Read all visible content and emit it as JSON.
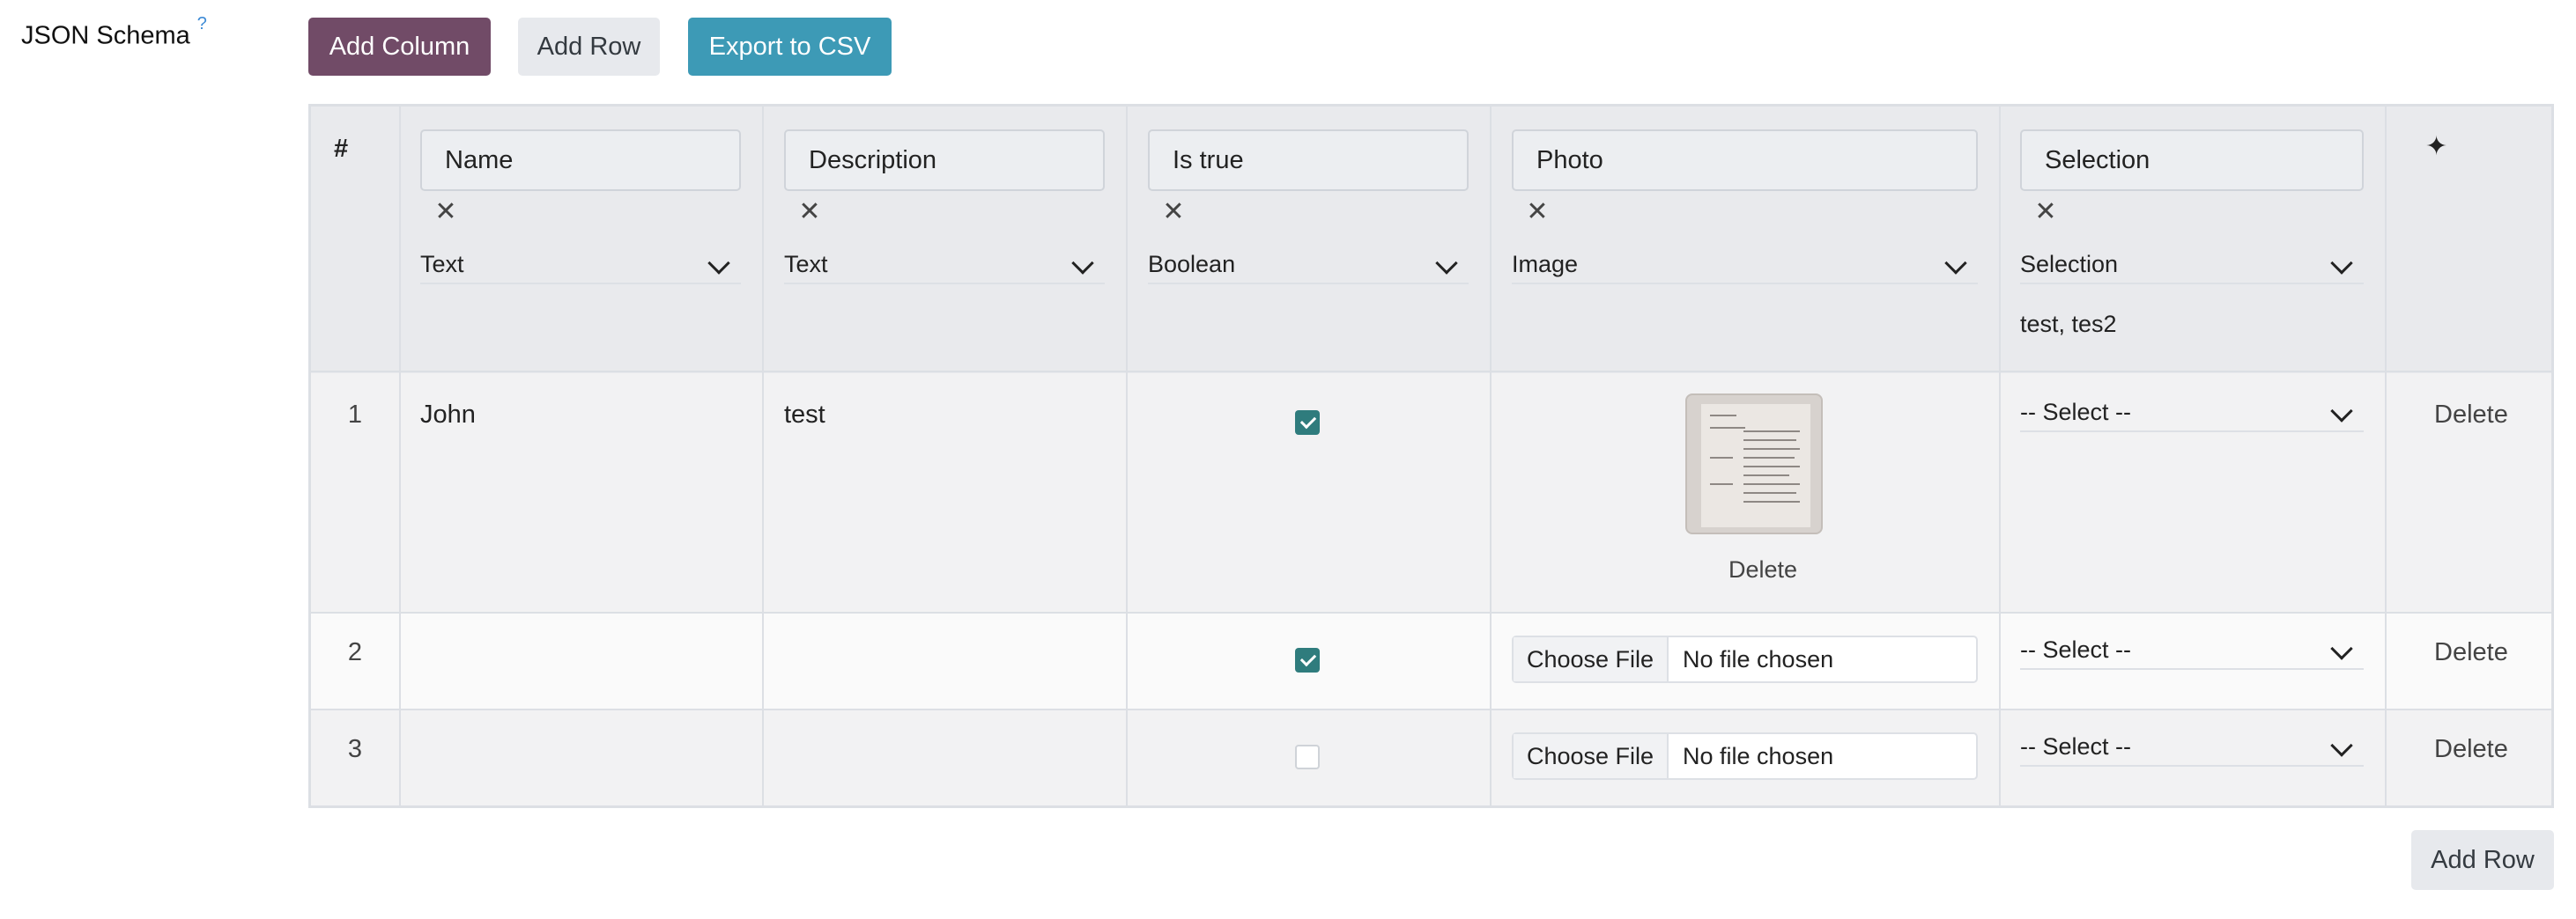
{
  "field": {
    "label": "JSON Schema",
    "help": "?"
  },
  "toolbar": {
    "add_column": "Add Column",
    "add_row": "Add Row",
    "export_csv": "Export to CSV"
  },
  "table": {
    "index_header": "#",
    "actions_icon": "sparkle-icon",
    "columns": [
      {
        "name": "Name",
        "type": "Text"
      },
      {
        "name": "Description",
        "type": "Text"
      },
      {
        "name": "Is true",
        "type": "Boolean"
      },
      {
        "name": "Photo",
        "type": "Image"
      },
      {
        "name": "Selection",
        "type": "Selection",
        "options": "test, tes2"
      }
    ],
    "rows": [
      {
        "num": "1",
        "name": "John",
        "description": "test",
        "is_true": true,
        "photo": "image-thumbnail",
        "photo_delete": "Delete",
        "selection": "-- Select --",
        "delete": "Delete"
      },
      {
        "num": "2",
        "name": "",
        "description": "",
        "is_true": true,
        "file_button": "Choose File",
        "file_status": "No file chosen",
        "selection": "-- Select --",
        "delete": "Delete"
      },
      {
        "num": "3",
        "name": "",
        "description": "",
        "is_true": false,
        "file_button": "Choose File",
        "file_status": "No file chosen",
        "selection": "-- Select --",
        "delete": "Delete"
      }
    ]
  },
  "footer": {
    "add_row": "Add Row"
  },
  "colors": {
    "primary": "#714b67",
    "info": "#3d9ab6",
    "checkbox": "#2f7c7d"
  }
}
